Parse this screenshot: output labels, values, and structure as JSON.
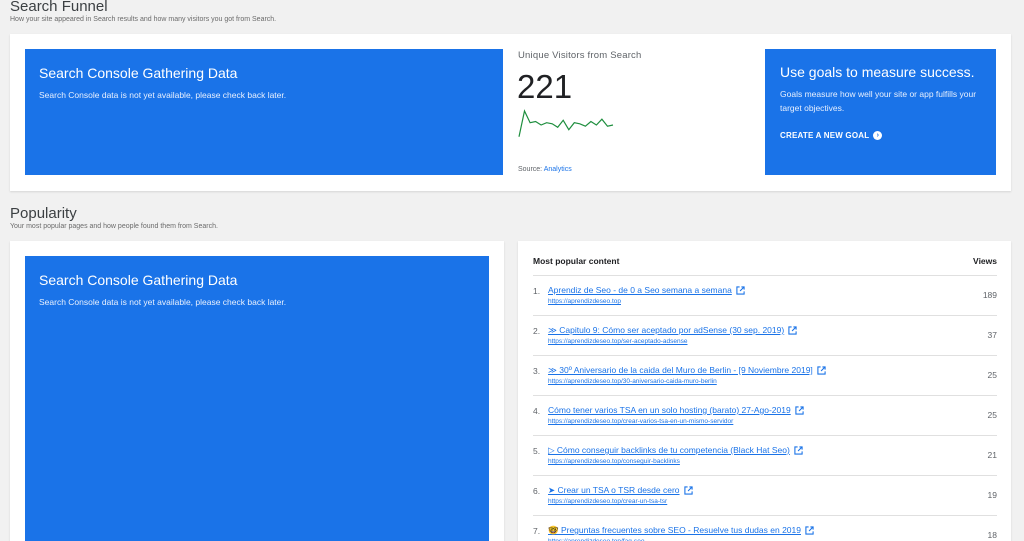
{
  "search_funnel": {
    "title": "Search Funnel",
    "subtitle": "How your site appeared in Search results and how many visitors you got from Search.",
    "gathering_card": {
      "title": "Search Console Gathering Data",
      "body": "Search Console data is not yet available, please check back later."
    },
    "visitors": {
      "label": "Unique Visitors from Search",
      "value": "221",
      "source_prefix": "Source:",
      "source_link": "Analytics",
      "sparkline_color": "#1e8e3e",
      "sparkline": [
        2,
        24,
        14,
        15,
        12,
        14,
        13,
        10,
        16,
        8,
        14,
        13,
        11,
        15,
        12,
        17,
        11,
        12
      ]
    },
    "goals_card": {
      "title": "Use goals to measure success.",
      "body": "Goals measure how well your site or app fulfills your target objectives.",
      "cta": "CREATE A NEW GOAL"
    }
  },
  "popularity": {
    "title": "Popularity",
    "subtitle": "Your most popular pages and how people found them from Search.",
    "gathering_card": {
      "title": "Search Console Gathering Data",
      "body": "Search Console data is not yet available, please check back later."
    },
    "table": {
      "col_content": "Most popular content",
      "col_views": "Views",
      "rows": [
        {
          "num": "1.",
          "title": "Aprendiz de Seo - de 0 a Seo semana a semana",
          "url": "https://aprendizdeseo.top",
          "views": "189"
        },
        {
          "num": "2.",
          "title": "≫ Capitulo 9: Cómo ser aceptado por adSense (30 sep. 2019)",
          "url": "https://aprendizdeseo.top/ser-aceptado-adsense",
          "views": "37"
        },
        {
          "num": "3.",
          "title": "≫ 30º Aniversario de la caida del Muro de Berlin - [9 Noviembre 2019]",
          "url": "https://aprendizdeseo.top/30-aniversario-caida-muro-berlin",
          "views": "25"
        },
        {
          "num": "4.",
          "title": "Cómo tener varios TSA en un solo hosting (barato) 27-Ago-2019",
          "url": "https://aprendizdeseo.top/crear-varios-tsa-en-un-mismo-servidor",
          "views": "25"
        },
        {
          "num": "5.",
          "title": "▷ Cómo conseguir backlinks de tu competencia (Black Hat Seo)",
          "url": "https://aprendizdeseo.top/conseguir-backlinks",
          "views": "21"
        },
        {
          "num": "6.",
          "title": "➤ Crear un TSA o TSR desde cero",
          "url": "https://aprendizdeseo.top/crear-un-tsa-tsr",
          "views": "19"
        },
        {
          "num": "7.",
          "title": "🤓 Preguntas frecuentes sobre SEO - Resuelve tus dudas en 2019",
          "url": "https://aprendizdeseo.top/faq-seo",
          "views": "18"
        }
      ]
    }
  }
}
